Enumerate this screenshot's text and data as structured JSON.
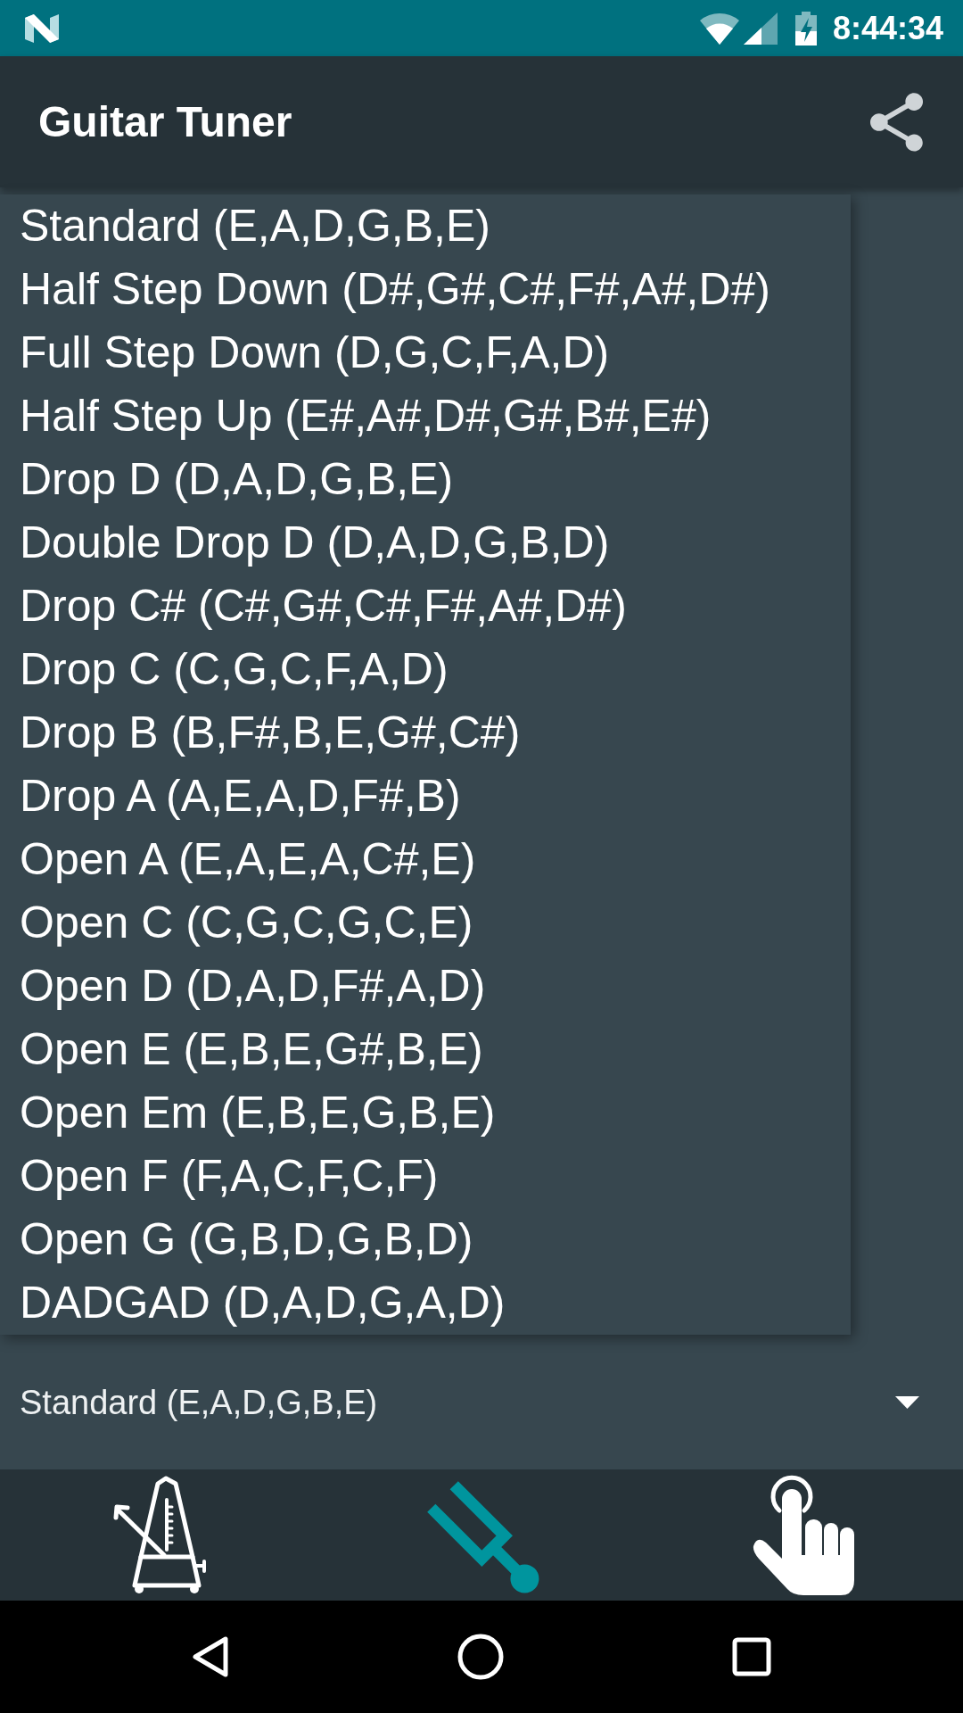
{
  "status_bar": {
    "time": "8:44:34"
  },
  "app_bar": {
    "title": "Guitar Tuner"
  },
  "tuning_menu": {
    "items": [
      "Standard (E,A,D,G,B,E)",
      "Half Step Down (D#,G#,C#,F#,A#,D#)",
      "Full Step Down (D,G,C,F,A,D)",
      "Half Step Up (E#,A#,D#,G#,B#,E#)",
      "Drop D (D,A,D,G,B,E)",
      "Double Drop D (D,A,D,G,B,D)",
      "Drop C# (C#,G#,C#,F#,A#,D#)",
      "Drop C (C,G,C,F,A,D)",
      "Drop B (B,F#,B,E,G#,C#)",
      "Drop A (A,E,A,D,F#,B)",
      "Open A (E,A,E,A,C#,E)",
      "Open C (C,G,C,G,C,E)",
      "Open D (D,A,D,F#,A,D)",
      "Open E (E,B,E,G#,B,E)",
      "Open Em (E,B,E,G,B,E)",
      "Open F (F,A,C,F,C,F)",
      "Open G (G,B,D,G,B,D)",
      "DADGAD (D,A,D,G,A,D)"
    ]
  },
  "tuning_spinner": {
    "value": "Standard (E,A,D,G,B,E)"
  },
  "bottom_bar": {
    "tabs": [
      {
        "kind": "metronome",
        "selected": false
      },
      {
        "kind": "tuning_fork",
        "selected": true
      },
      {
        "kind": "touch",
        "selected": false
      }
    ]
  }
}
